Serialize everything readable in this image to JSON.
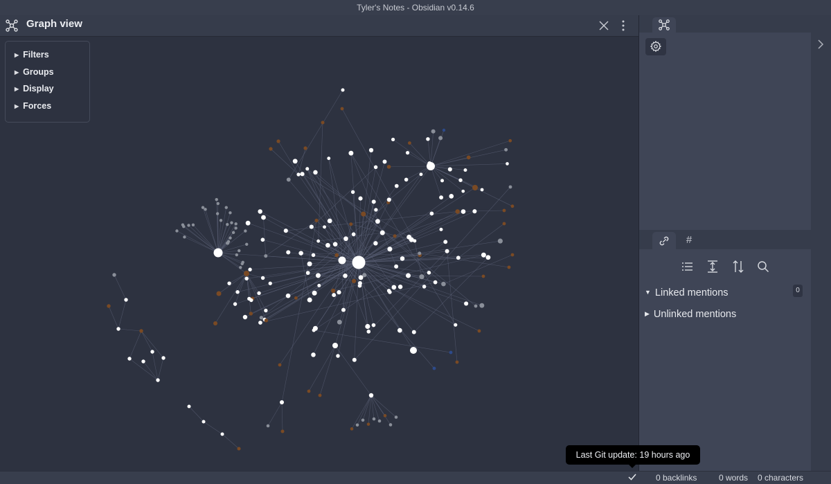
{
  "window": {
    "title": "Tyler's Notes - Obsidian v0.14.6"
  },
  "graph_view": {
    "title": "Graph view",
    "controls": [
      "Filters",
      "Groups",
      "Display",
      "Forces"
    ],
    "icons": {
      "header": "graph-icon",
      "close": "close-icon",
      "more": "more-options-icon"
    },
    "colors": {
      "node": "#ffffff",
      "node_unresolved": "#8a8f99",
      "node_attachment": "#7a4a24",
      "node_tag": "#2d4a8a",
      "edge": "#5a6075",
      "background": "#2d3240"
    }
  },
  "right_sidebar": {
    "top_tab_icon": "graph-icon",
    "settings_icon": "gear-icon",
    "collapse_icon": "chevron-right-icon",
    "bottom_tabs": [
      {
        "icon": "backlinks-icon"
      },
      {
        "icon": "tag-icon",
        "label": "#"
      }
    ],
    "toolbar_icons": [
      "list-icon",
      "expand-vertical-icon",
      "sort-icon",
      "search-icon"
    ],
    "linked_mentions": {
      "label": "Linked mentions",
      "count": "0"
    },
    "unlinked_mentions": {
      "label": "Unlinked mentions"
    }
  },
  "statusbar": {
    "tooltip": "Last Git update: 19 hours ago",
    "git_icon": "check-icon",
    "backlinks": "0 backlinks",
    "words": "0 words",
    "characters": "0 characters"
  }
}
